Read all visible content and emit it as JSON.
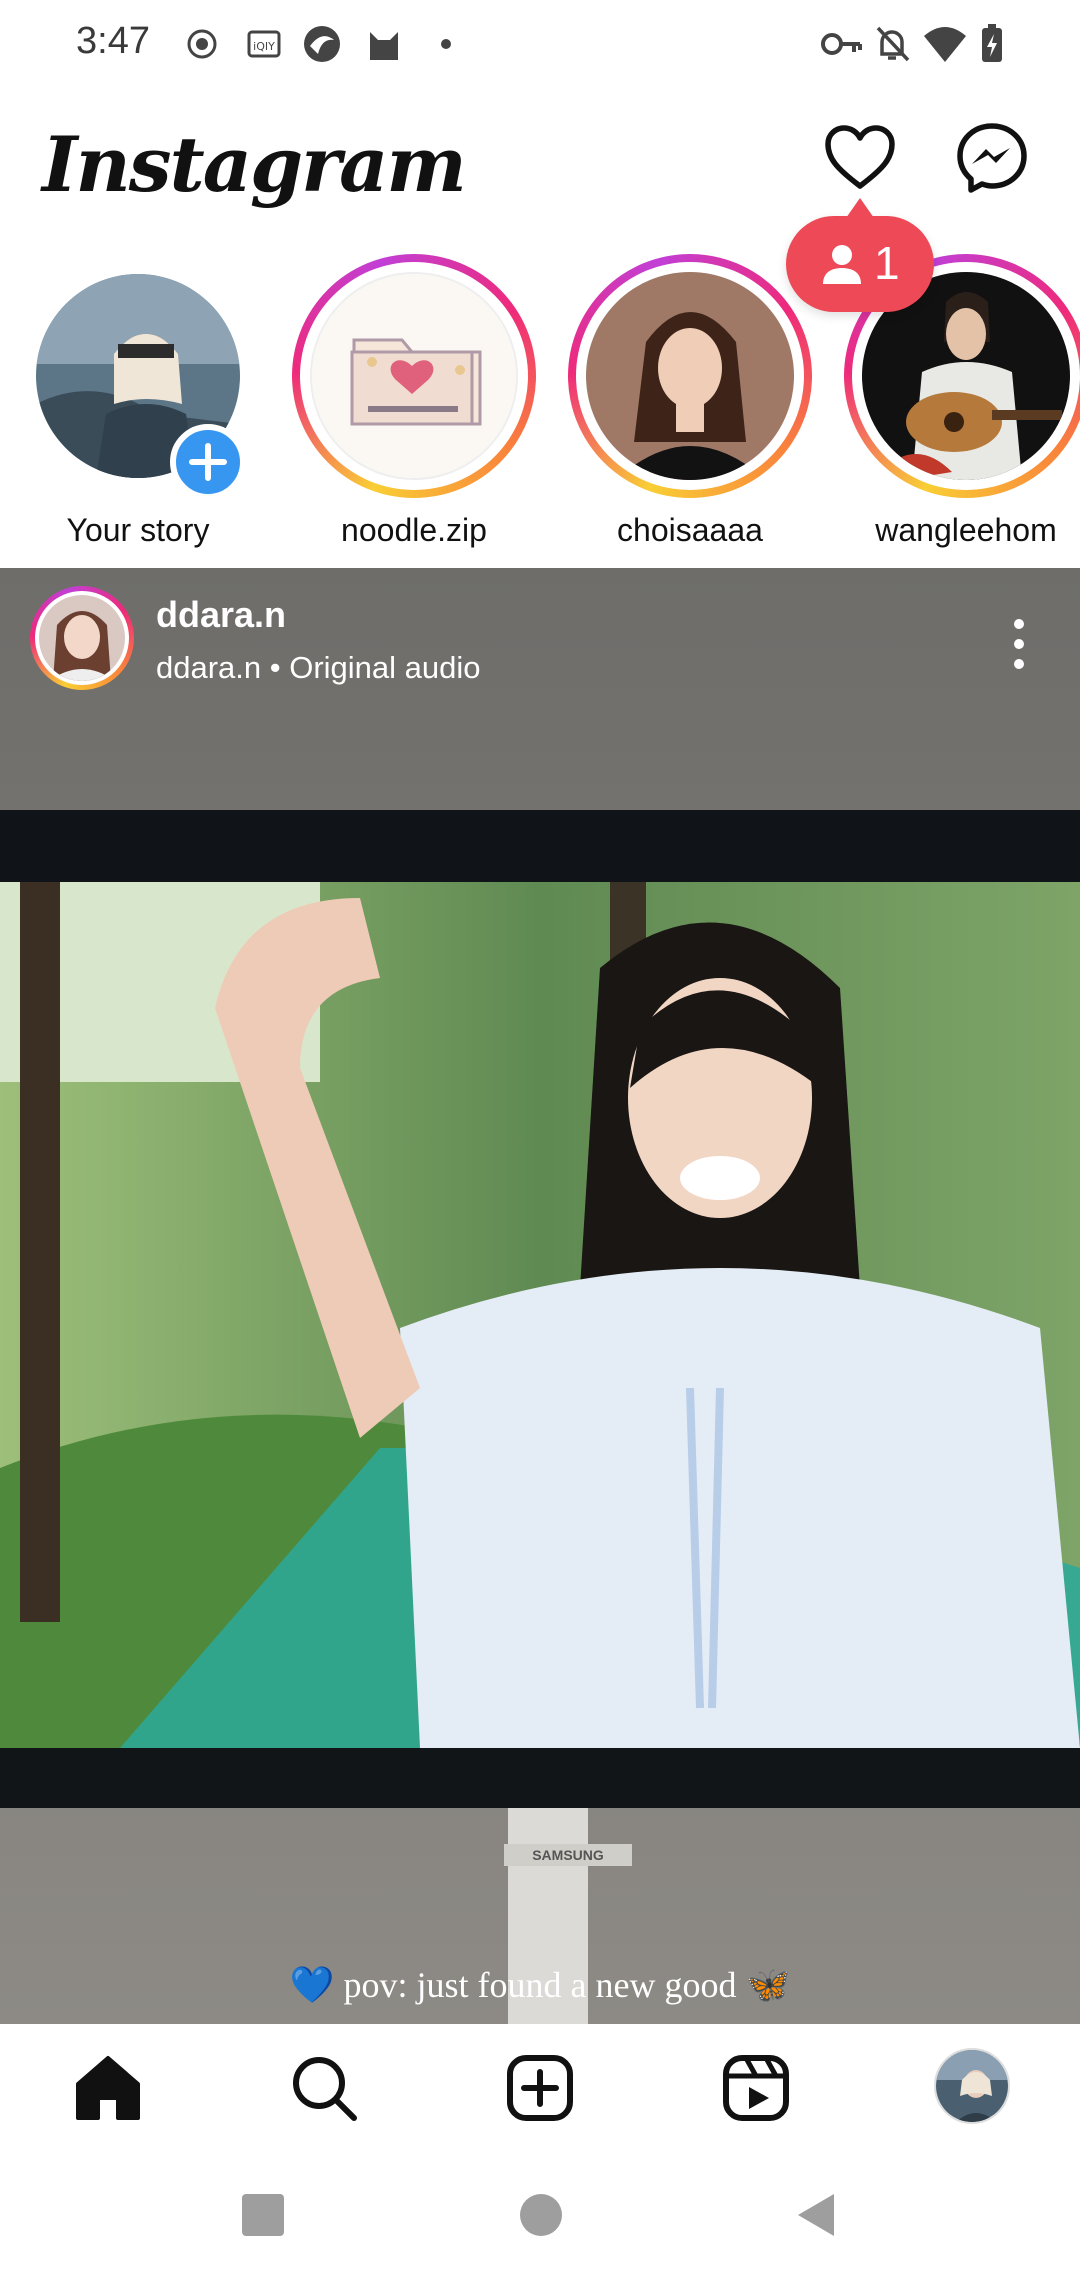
{
  "status_bar": {
    "time": "3:47",
    "left_icons": [
      "record-icon",
      "iqiyi-icon",
      "app-icon",
      "cat-icon",
      "dot-icon"
    ],
    "right_icons": [
      "key-icon",
      "bell-off-icon",
      "wifi-icon",
      "battery-charging-icon"
    ]
  },
  "header": {
    "logo": "Instagram",
    "notification_count": "1",
    "icons": [
      "heart-icon",
      "messenger-icon"
    ]
  },
  "stories": [
    {
      "label": "Your story",
      "has_add": true
    },
    {
      "label": "noodle.zip"
    },
    {
      "label": "choisaaaa"
    },
    {
      "label": "wangleehom"
    }
  ],
  "post": {
    "username": "ddara.n",
    "subtitle": "ddara.n • Original audio",
    "caption": "💙 pov: just found a new good 🦋",
    "monitor_brand": "SAMSUNG"
  },
  "bottom_nav": {
    "items": [
      "home-icon",
      "search-icon",
      "create-icon",
      "reels-icon",
      "profile-avatar"
    ]
  },
  "colors": {
    "accent_red": "#ed4956",
    "accent_blue": "#3797f0"
  }
}
